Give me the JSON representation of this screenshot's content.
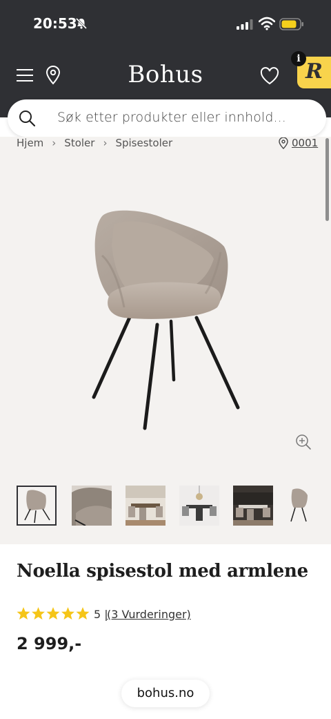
{
  "status_bar": {
    "time": "20:53"
  },
  "header": {
    "logo": "Bohus",
    "badge_letter": "R",
    "info_letter": "i"
  },
  "search": {
    "placeholder": "Søk etter produkter eller innhold..."
  },
  "breadcrumb": {
    "items": [
      "Hjem",
      "Stoler",
      "Spisestoler"
    ],
    "store_code": "0001"
  },
  "gallery": {
    "thumbnails": [
      "Chair front view",
      "Chair fabric detail",
      "Dining room scene",
      "Dining table set",
      "Dining room dark scene",
      "Chair side view"
    ]
  },
  "product": {
    "title": "Noella spisestol med armlene",
    "rating": "5",
    "rating_sep": "|",
    "reviews": "(3 Vurderinger)",
    "price": "2 999,-",
    "star_color": "#f5c518",
    "stars_count": 5
  },
  "footer": {
    "url": "bohus.no"
  },
  "colors": {
    "header_bg": "#2f3034",
    "gallery_bg": "#f4f2f0",
    "accent": "#f8d34c"
  }
}
